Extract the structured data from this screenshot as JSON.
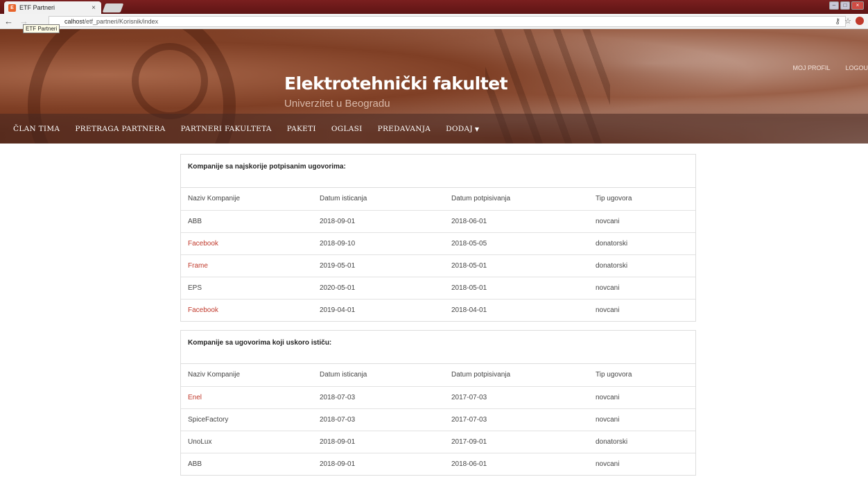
{
  "browser": {
    "tab_title": "ETF Partneri",
    "tab_close": "×",
    "favicon_glyph": "E",
    "tooltip": "ETF Partneri",
    "url_host": "calhost",
    "url_path": "/etf_partneri/Korisnik/index",
    "back_icon": "←",
    "forward_icon": "→",
    "key_icon": "⚷",
    "star_icon": "☆"
  },
  "header": {
    "title": "Elektrotehnički fakultet",
    "subtitle": "Univerzitet u Beogradu",
    "profile_link": "MOJ PROFIL",
    "logout_link": "LOGOU"
  },
  "nav": {
    "items": [
      "ČLAN TIMA",
      "PRETRAGA PARTNERA",
      "PARTNERI FAKULTETA",
      "PAKETI",
      "OGLASI",
      "PREDAVANJA"
    ],
    "dropdown_label": "DODAJ",
    "dropdown_caret": "▼"
  },
  "table_recent": {
    "title": "Kompanije sa najskorije potpisanim ugovorima:",
    "headers": [
      "Naziv Kompanije",
      "Datum isticanja",
      "Datum potpisivanja",
      "Tip ugovora"
    ],
    "rows": [
      {
        "name": "ABB",
        "expires": "2018-09-01",
        "signed": "2018-06-01",
        "type": "novcani",
        "link": false
      },
      {
        "name": "Facebook",
        "expires": "2018-09-10",
        "signed": "2018-05-05",
        "type": "donatorski",
        "link": true
      },
      {
        "name": "Frame",
        "expires": "2019-05-01",
        "signed": "2018-05-01",
        "type": "donatorski",
        "link": true
      },
      {
        "name": "EPS",
        "expires": "2020-05-01",
        "signed": "2018-05-01",
        "type": "novcani",
        "link": false
      },
      {
        "name": "Facebook",
        "expires": "2019-04-01",
        "signed": "2018-04-01",
        "type": "novcani",
        "link": true
      }
    ]
  },
  "table_expiring": {
    "title": "Kompanije sa ugovorima koji uskoro ističu:",
    "headers": [
      "Naziv Kompanije",
      "Datum isticanja",
      "Datum potpisivanja",
      "Tip ugovora"
    ],
    "rows": [
      {
        "name": "Enel",
        "expires": "2018-07-03",
        "signed": "2017-07-03",
        "type": "novcani",
        "link": true
      },
      {
        "name": "SpiceFactory",
        "expires": "2018-07-03",
        "signed": "2017-07-03",
        "type": "novcani",
        "link": false
      },
      {
        "name": "UnoLux",
        "expires": "2018-09-01",
        "signed": "2017-09-01",
        "type": "donatorski",
        "link": false
      },
      {
        "name": "ABB",
        "expires": "2018-09-01",
        "signed": "2018-06-01",
        "type": "novcani",
        "link": false
      }
    ]
  },
  "colors": {
    "link_red": "#c0392b",
    "banner_brown": "#7f3f25"
  }
}
